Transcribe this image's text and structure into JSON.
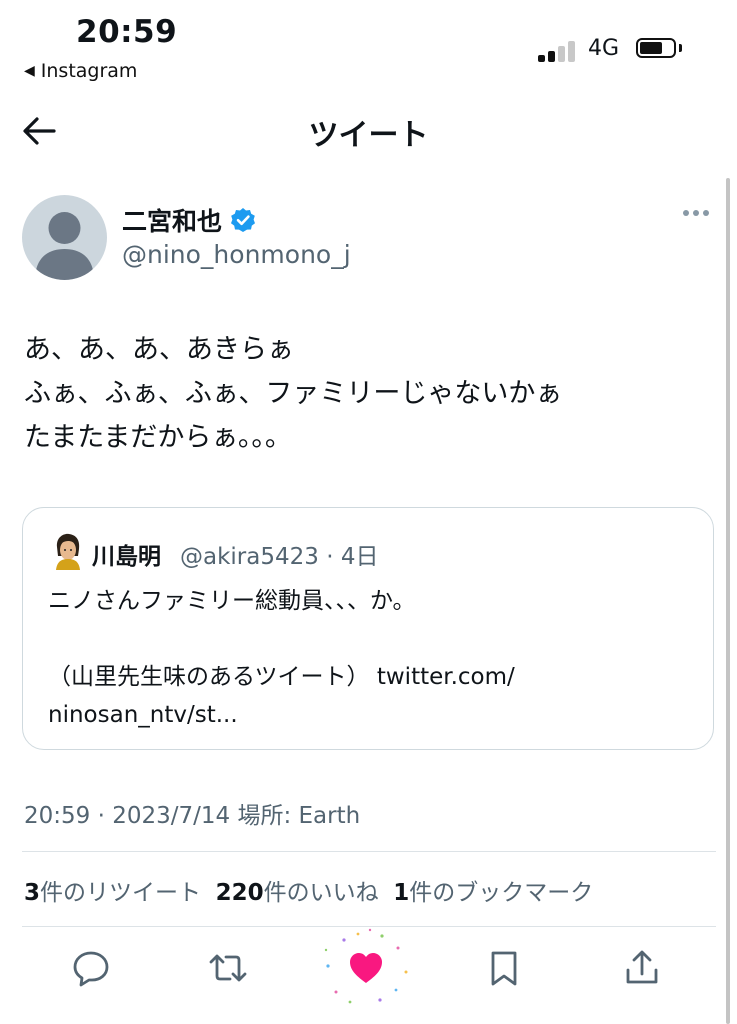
{
  "status_bar": {
    "time": "20:59",
    "back_app": "Instagram",
    "network": "4G",
    "battery_level": 0.7
  },
  "header": {
    "title": "ツイート"
  },
  "tweet": {
    "display_name": "二宮和也",
    "handle": "@nino_honmono_j",
    "text": "あ、あ、あ、あきらぁ\nふぁ、ふぁ、ふぁ、ファミリーじゃないかぁ\nたまたまだからぁ。。。",
    "timestamp": "20:59 · 2023/7/14 場所: Earth",
    "stats": {
      "retweets_count": "3",
      "retweets_label": "件のリツイート",
      "likes_count": "220",
      "likes_label": "件のいいね",
      "bookmarks_count": "1",
      "bookmarks_label": "件のブックマーク"
    }
  },
  "quote": {
    "name": "川島明",
    "meta": "@akira5423 · 4日",
    "text": "ニノさんファミリー総動員、、、か。\n\n（山里先生味のあるツイート） twitter.com/\nninosan_ntv/st..."
  },
  "colors": {
    "accent": "#f91880",
    "verified": "#1d9bf0",
    "secondary_text": "#536471"
  },
  "icons": [
    "back-arrow-icon",
    "verified-badge-icon",
    "more-icon",
    "reply-icon",
    "retweet-icon",
    "like-icon",
    "bookmark-icon",
    "share-icon"
  ]
}
